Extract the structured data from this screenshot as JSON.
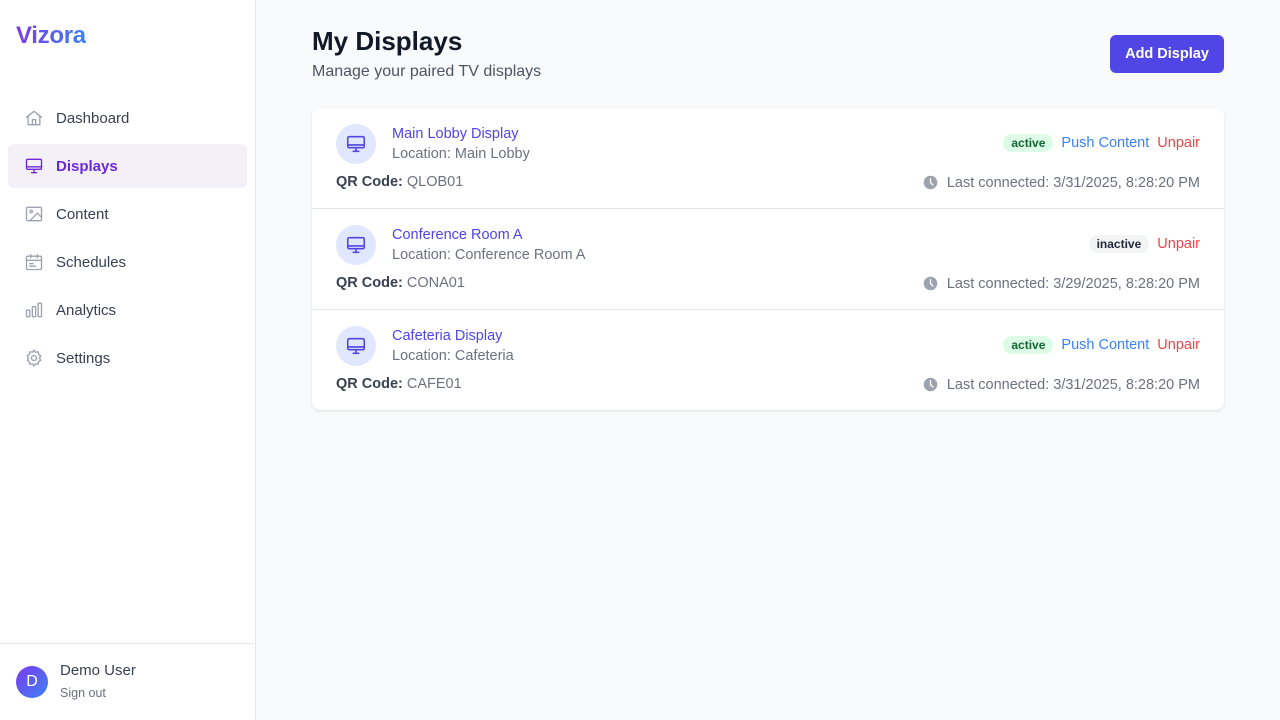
{
  "app": {
    "brand": "Vizora"
  },
  "sidebar": {
    "items": [
      {
        "label": "Dashboard",
        "icon": "home-icon",
        "active": false
      },
      {
        "label": "Displays",
        "icon": "monitor-icon",
        "active": true
      },
      {
        "label": "Content",
        "icon": "image-icon",
        "active": false
      },
      {
        "label": "Schedules",
        "icon": "calendar-icon",
        "active": false
      },
      {
        "label": "Analytics",
        "icon": "bar-chart-icon",
        "active": false
      },
      {
        "label": "Settings",
        "icon": "gear-icon",
        "active": false
      }
    ],
    "user": {
      "initial": "D",
      "name": "Demo User",
      "signout": "Sign out"
    }
  },
  "header": {
    "title": "My Displays",
    "subtitle": "Manage your paired TV displays",
    "add_button": "Add Display"
  },
  "labels": {
    "qr_prefix": "QR Code:",
    "push": "Push Content",
    "unpair": "Unpair"
  },
  "displays": [
    {
      "name": "Main Lobby Display",
      "location": "Location: Main Lobby",
      "qr": "QLOB01",
      "status": "active",
      "last": "Last connected: 3/31/2025, 8:28:20 PM"
    },
    {
      "name": "Conference Room A",
      "location": "Location: Conference Room A",
      "qr": "CONA01",
      "status": "inactive",
      "last": "Last connected: 3/29/2025, 8:28:20 PM"
    },
    {
      "name": "Cafeteria Display",
      "location": "Location: Cafeteria",
      "qr": "CAFE01",
      "status": "active",
      "last": "Last connected: 3/31/2025, 8:28:20 PM"
    }
  ],
  "colors": {
    "accent": "#4f46e5",
    "brand_from": "#7c3aed",
    "brand_to": "#3b82f6",
    "active_badge_bg": "#dcfce7",
    "danger": "#ef4444"
  }
}
